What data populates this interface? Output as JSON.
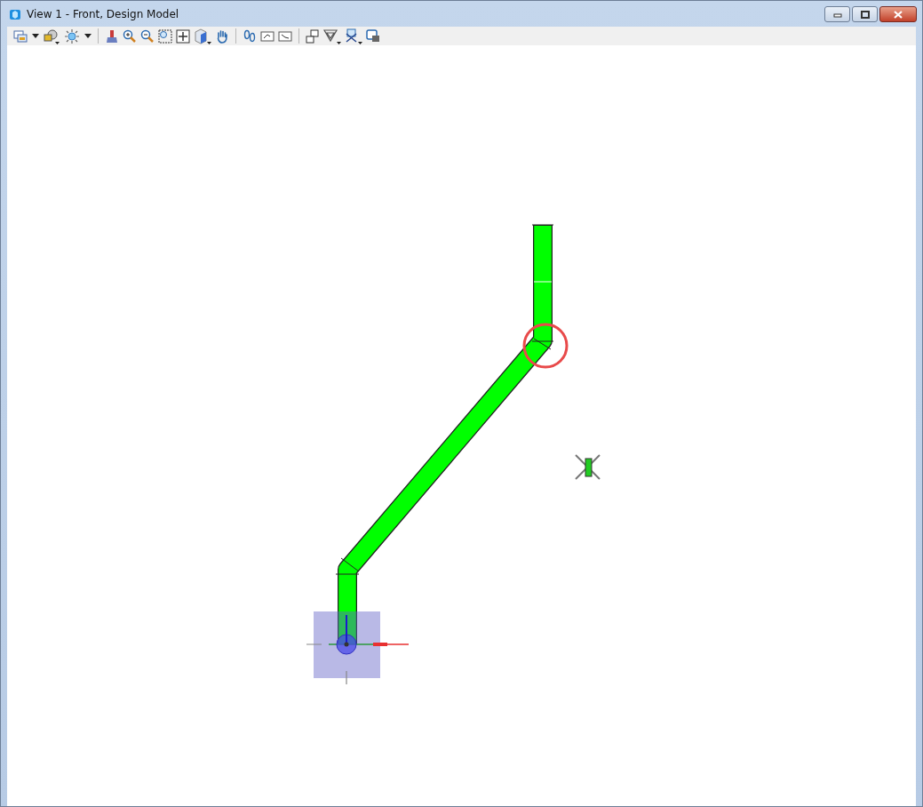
{
  "window": {
    "title": "View 1 - Front, Design Model"
  }
}
